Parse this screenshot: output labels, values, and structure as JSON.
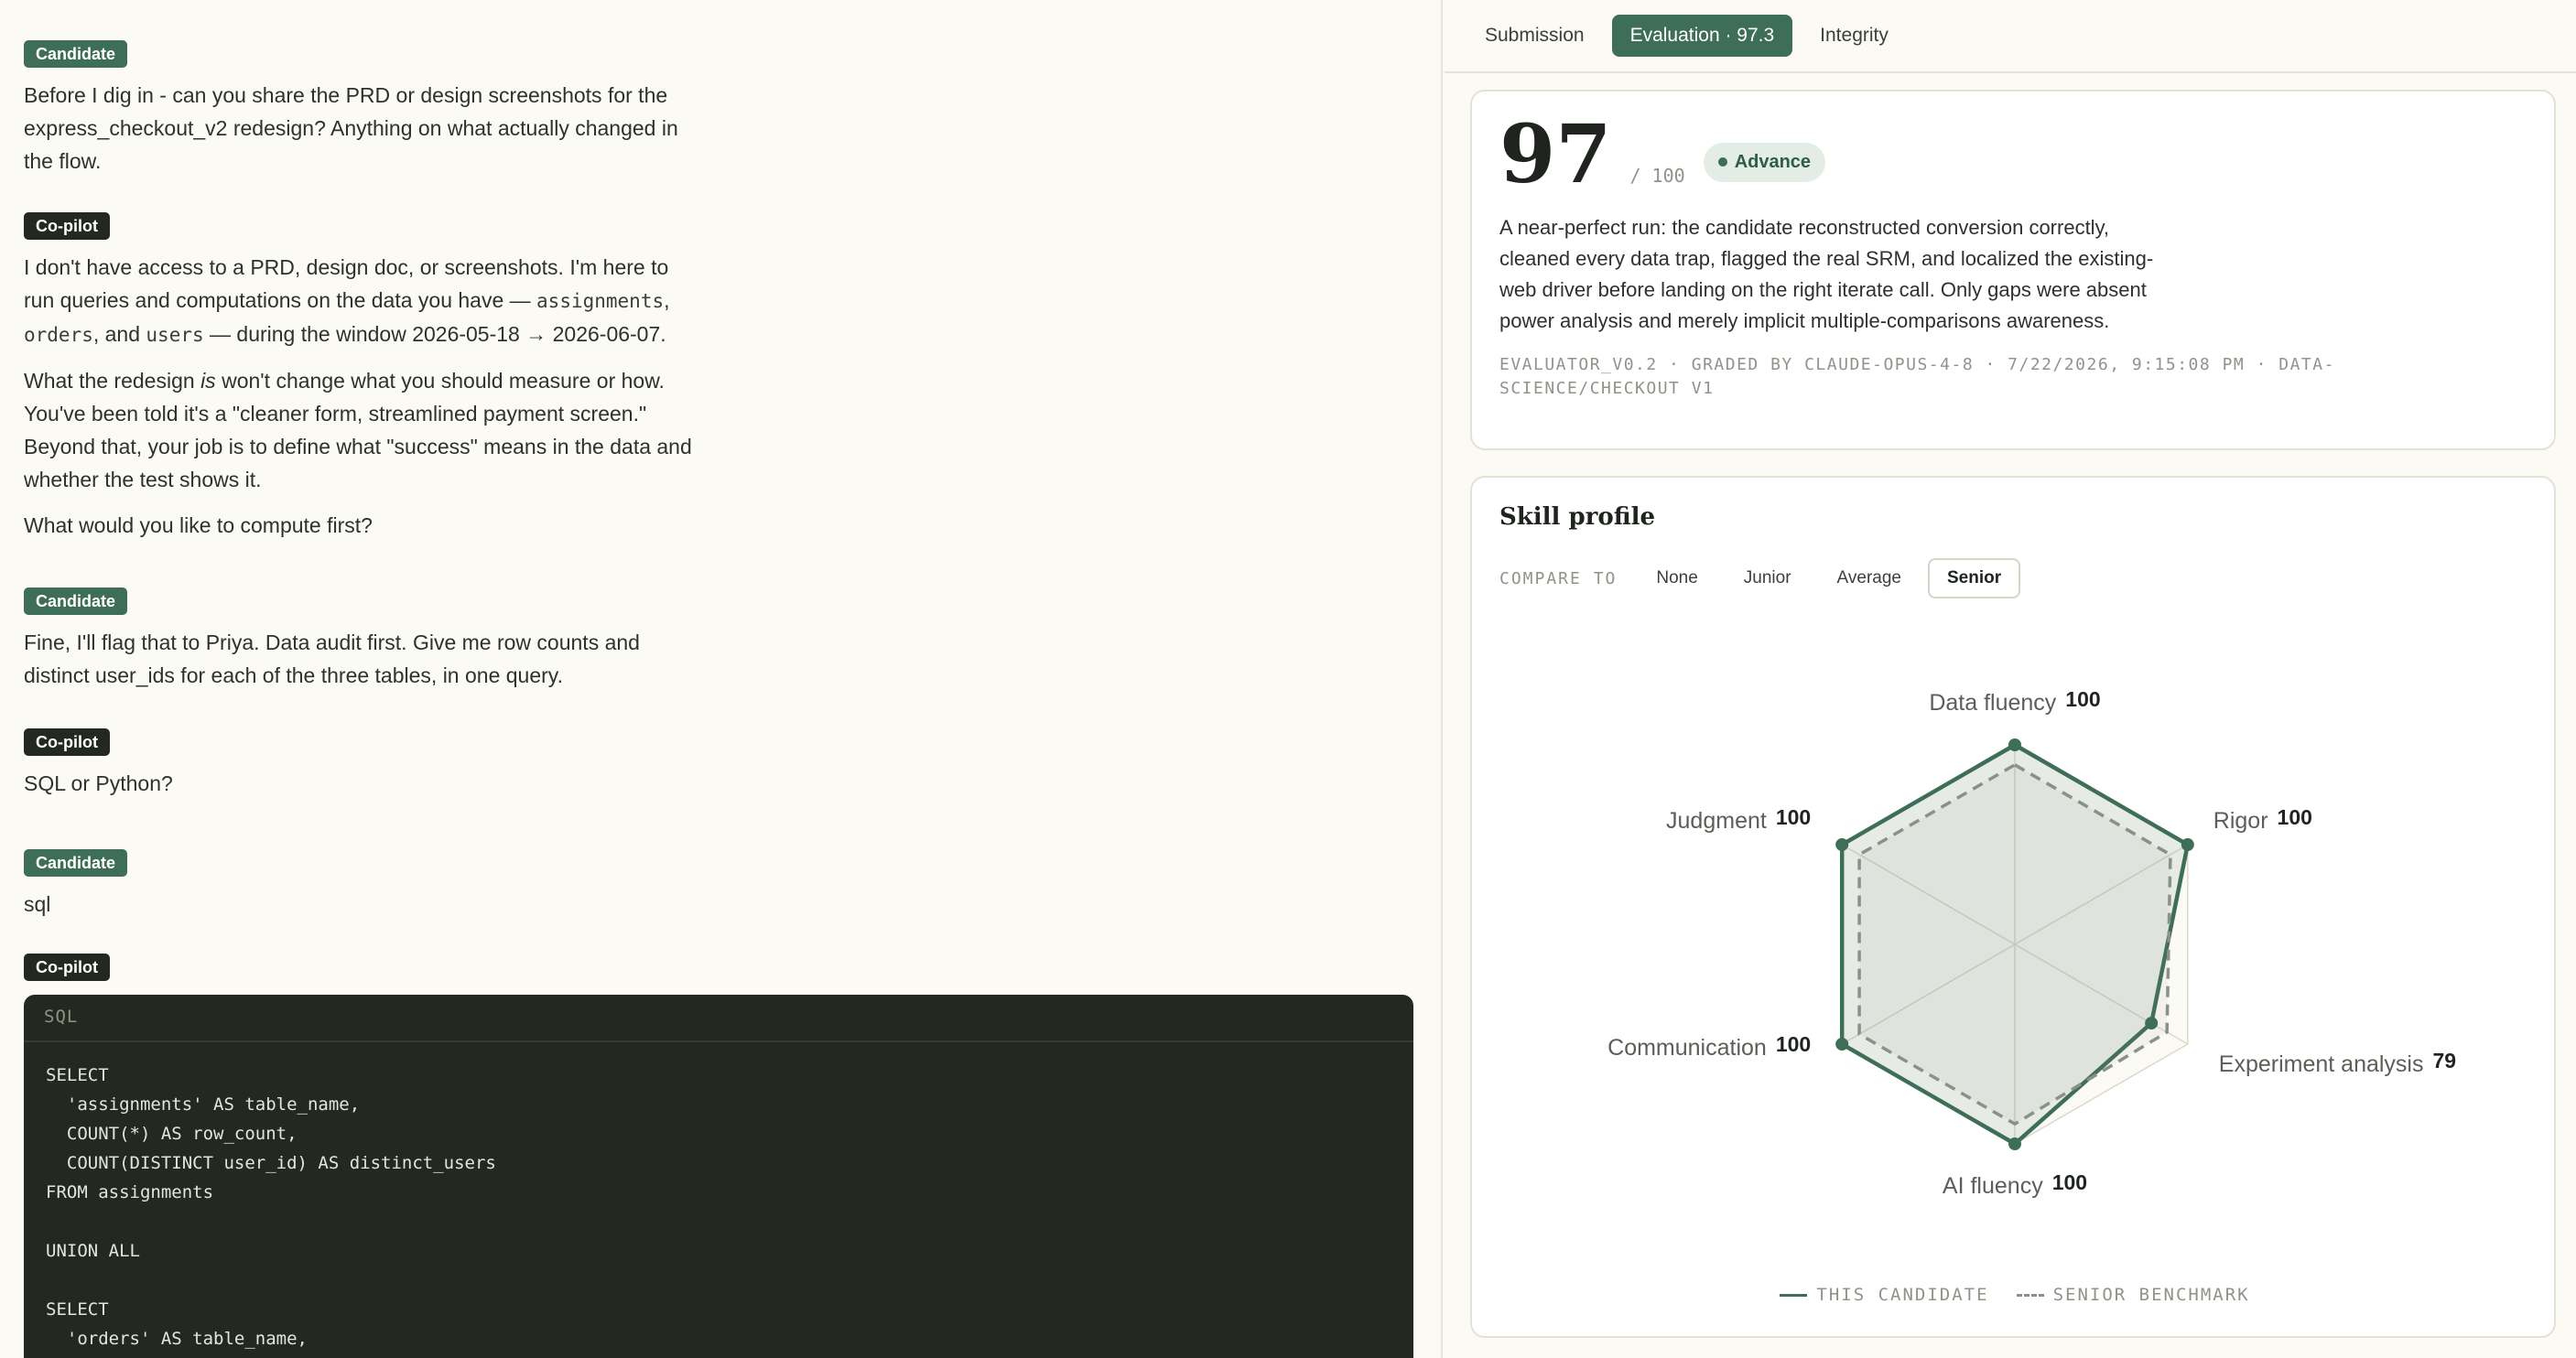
{
  "chat": {
    "messages": [
      {
        "role": "Candidate",
        "paragraphs": [
          "Before I dig in - can you share the PRD or design screenshots for the express_checkout_v2 redesign? Anything on what actually changed in the flow."
        ]
      },
      {
        "role": "Co-pilot",
        "paragraphs": [
          {
            "parts": [
              "I don't have access to a PRD, design doc, or screenshots. I'm here to run queries and computations on the data you have — ",
              "assignments",
              ", ",
              "orders",
              ", and ",
              "users",
              " — during the window 2026-05-18 → 2026-06-07."
            ]
          },
          {
            "parts": [
              "What the redesign ",
              "is",
              " won't change what you should measure or how. You've been told it's a \"cleaner form, streamlined payment screen.\" Beyond that, your job is to define what \"success\" means in the data and whether the test shows it."
            ]
          },
          "What would you like to compute first?"
        ]
      },
      {
        "role": "Candidate",
        "paragraphs": [
          "Fine, I'll flag that to Priya. Data audit first. Give me row counts and distinct user_ids for each of the three tables, in one query."
        ]
      },
      {
        "role": "Co-pilot",
        "paragraphs": [
          "SQL or Python?"
        ]
      },
      {
        "role": "Candidate",
        "paragraphs": [
          "sql"
        ]
      },
      {
        "role": "Co-pilot",
        "paragraphs": []
      }
    ],
    "code": {
      "language": "SQL",
      "lines": [
        "SELECT",
        "  'assignments' AS table_name,",
        "  COUNT(*) AS row_count,",
        "  COUNT(DISTINCT user_id) AS distinct_users",
        "FROM assignments",
        "",
        "UNION ALL",
        "",
        "SELECT",
        "  'orders' AS table_name,"
      ]
    }
  },
  "tabs": [
    "Submission",
    "Evaluation · 97.3",
    "Integrity"
  ],
  "active_tab": 1,
  "score": {
    "value": "97",
    "max": "/ 100",
    "decision": "Advance",
    "summary": "A near-perfect run: the candidate reconstructed conversion correctly, cleaned every data trap, flagged the real SRM, and localized the existing-web driver before landing on the right iterate call. Only gaps were absent power analysis and merely implicit multiple-comparisons awareness.",
    "meta": "EVALUATOR_V0.2 · GRADED BY CLAUDE-OPUS-4-8 · 7/22/2026, 9:15:08 PM · DATA-SCIENCE/CHECKOUT V1"
  },
  "skill_profile": {
    "title": "Skill profile",
    "compare_label": "COMPARE TO",
    "compare_options": [
      "None",
      "Junior",
      "Average",
      "Senior"
    ],
    "compare_selected": 3,
    "legend": {
      "candidate": "THIS CANDIDATE",
      "benchmark": "SENIOR BENCHMARK"
    }
  },
  "chart_data": {
    "type": "radar",
    "axes": [
      "Data fluency",
      "Rigor",
      "Experiment analysis",
      "AI fluency",
      "Communication",
      "Judgment"
    ],
    "max": 100,
    "series": [
      {
        "name": "THIS CANDIDATE",
        "values": [
          100,
          100,
          79,
          100,
          100,
          100
        ],
        "color": "#3e6e57",
        "style": "solid"
      },
      {
        "name": "SENIOR BENCHMARK",
        "values": [
          90,
          90,
          88,
          90,
          90,
          90
        ],
        "color": "#8a9185",
        "style": "dashed"
      }
    ],
    "value_labels": [
      "100",
      "100",
      "79",
      "100",
      "100",
      "100"
    ],
    "rings": 5
  },
  "colors": {
    "accent": "#3e6e57",
    "copilot_badge": "#24291f",
    "code_bg": "#232820"
  }
}
